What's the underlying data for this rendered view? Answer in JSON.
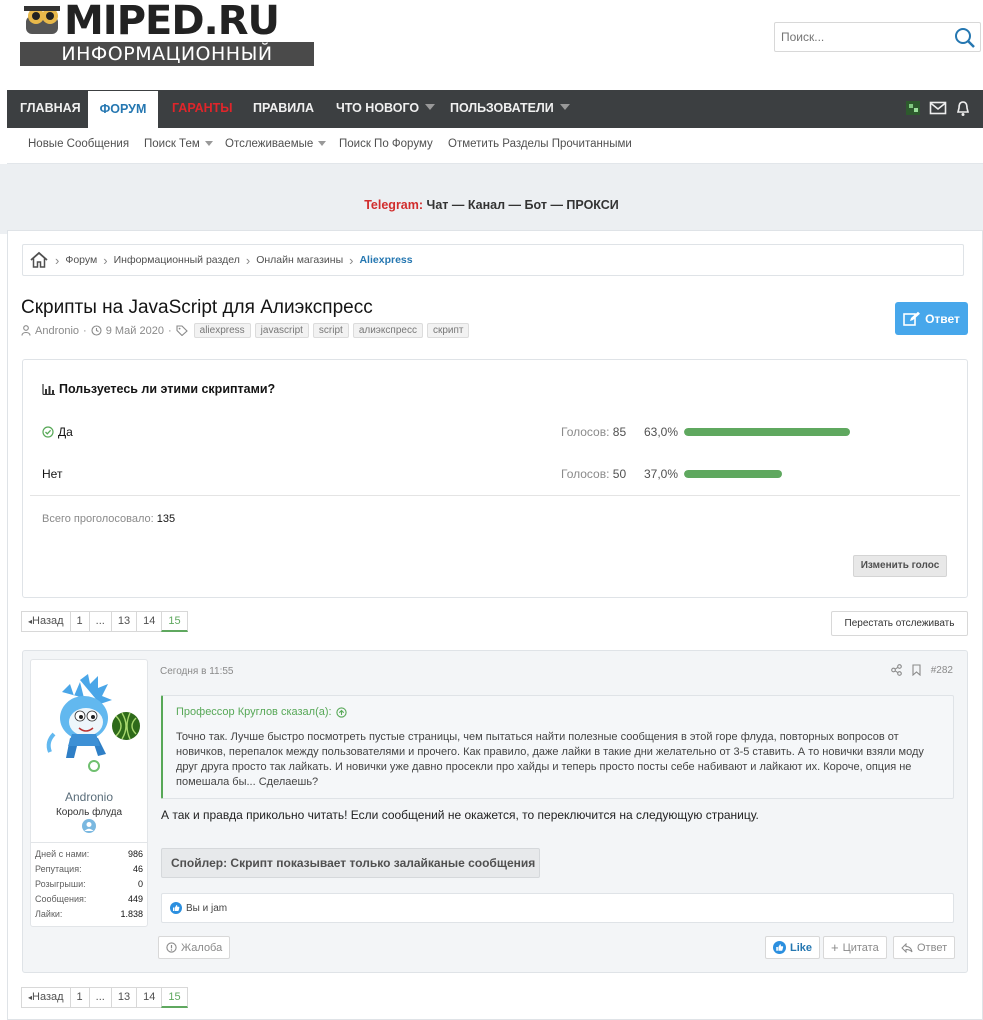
{
  "site": {
    "logo_text": "MIPED.RU",
    "logo_sub": "ИНФОРМАЦИОННЫЙ ПОРТАЛ",
    "search_placeholder": "Поиск..."
  },
  "nav": {
    "items": [
      {
        "label": "Главная"
      },
      {
        "label": "Форум"
      },
      {
        "label": "Гаранты"
      },
      {
        "label": "Правила"
      },
      {
        "label": "Что нового"
      },
      {
        "label": "Пользователи"
      }
    ],
    "sub": [
      {
        "label": "Новые Сообщения"
      },
      {
        "label": "Поиск Тем"
      },
      {
        "label": "Отслеживаемые"
      },
      {
        "label": "Поиск По Форуму"
      },
      {
        "label": "Отметить Разделы Прочитанными"
      }
    ]
  },
  "telegram": {
    "label": "Telegram:",
    "chat": "Чат",
    "dash1": "—",
    "channel": "Канал",
    "dash2": "—",
    "bot": "Бот",
    "dash3": "—",
    "proxy": "ПРОКСИ"
  },
  "breadcrumb": [
    "Форум",
    "Информационный раздел",
    "Онлайн магазины",
    "Aliexpress"
  ],
  "thread": {
    "title": "Скрипты на JavaScript для Алиэкспресс",
    "author": "Andronio",
    "date": "9 Май 2020",
    "tags": [
      "aliexpress",
      "javascript",
      "script",
      "алиэкспресс",
      "скрипт"
    ],
    "reply_label": "Ответ"
  },
  "poll": {
    "question": "Пользуетесь ли этими скриптами?",
    "votes_label": "Голосов:",
    "options": [
      {
        "label": "Да",
        "votes": "85",
        "pct": "63,0%",
        "fraction": 0.63
      },
      {
        "label": "Нет",
        "votes": "50",
        "pct": "37,0%",
        "fraction": 0.37
      }
    ],
    "total_label": "Всего проголосовало:",
    "total": "135",
    "change_label": "Изменить голос"
  },
  "pager": {
    "prev": "Назад",
    "pages": [
      "1",
      "...",
      "13",
      "14",
      "15"
    ],
    "current": "15",
    "unwatch": "Перестать отслеживать"
  },
  "post": {
    "user": {
      "name": "Andronio",
      "title": "Король флуда",
      "stats": [
        {
          "k": "Дней с нами:",
          "v": "986"
        },
        {
          "k": "Репутация:",
          "v": "46"
        },
        {
          "k": "Розыгрыши:",
          "v": "0"
        },
        {
          "k": "Сообщения:",
          "v": "449"
        },
        {
          "k": "Лайки:",
          "v": "1.838"
        }
      ]
    },
    "date": "Сегодня в 11:55",
    "number": "#282",
    "quote_author": "Профессор Круглов сказал(а):",
    "quote_text": "Точно так. Лучше быстро посмотреть пустые страницы, чем пытаться найти полезные сообщения в этой горе флуда, повторных вопросов от новичков, перепалок между пользователями и прочего. Как правило, даже лайки в такие дни желательно от 3-5 ставить. А то новички взяли моду друг друга просто так лайкать. И новички уже давно просекли про хайды и теперь просто посты себе набивают и лайкают их. Короче, опция не помешала бы... Сделаешь?",
    "text": "А так и правда прикольно читать! Если сообщений не окажется, то переключится на следующую страницу.",
    "spoiler": "Спойлер: Скрипт показывает только залайканые сообщения",
    "likes": "Вы и jam",
    "report": "Жалоба",
    "like": "Like",
    "quote_btn": "Цитата",
    "reply_btn": "Ответ"
  },
  "colors": {
    "accent": "#2577b1",
    "nav_bg": "#3c3f41",
    "bar": "#5fa85f",
    "button": "#47a7eb"
  }
}
